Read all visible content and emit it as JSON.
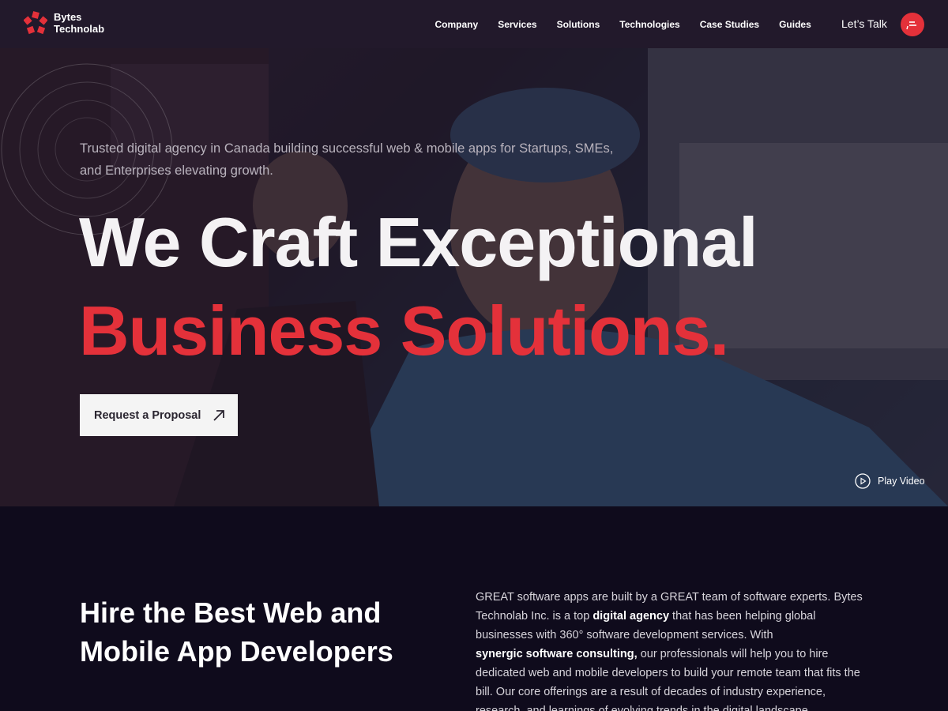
{
  "brand": {
    "line1": "Bytes",
    "line2": "Technolab",
    "color": "#e4313a"
  },
  "nav": {
    "links": [
      "Company",
      "Services",
      "Solutions",
      "Technologies",
      "Case Studies",
      "Guides"
    ],
    "cta_label": "Let’s Talk",
    "chat_icon": "chat-bubble-icon"
  },
  "hero": {
    "subtitle": "Trusted digital agency in Canada building successful web & mobile apps for Startups, SMEs, and Enterprises elevating growth.",
    "headline_line1": "We Craft Exceptional",
    "headline_line2": "Business Solutions.",
    "cta_label": "Request a Proposal",
    "cta_icon": "arrow-up-right-icon",
    "play_label": "Play Video",
    "play_icon": "play-circle-icon"
  },
  "section": {
    "heading": "Hire the Best Web and Mobile App Developers",
    "p_1": "GREAT software apps are built by a GREAT team of software experts. Bytes Technolab Inc. is a top ",
    "p_bold_1": "digital agency",
    "p_2": " that has been helping global businesses with 360° software development services. With ",
    "p_bold_2": "synergic software consulting,",
    "p_3": " our professionals will help you to hire dedicated web and mobile developers to build your remote team that fits the bill. Our core offerings are a result of decades of industry experience, research, and learnings of evolving trends in the digital landscape."
  },
  "colors": {
    "accent": "#e4313a",
    "nav_bg": "#22192b",
    "page_bg": "#0f0b1c"
  }
}
